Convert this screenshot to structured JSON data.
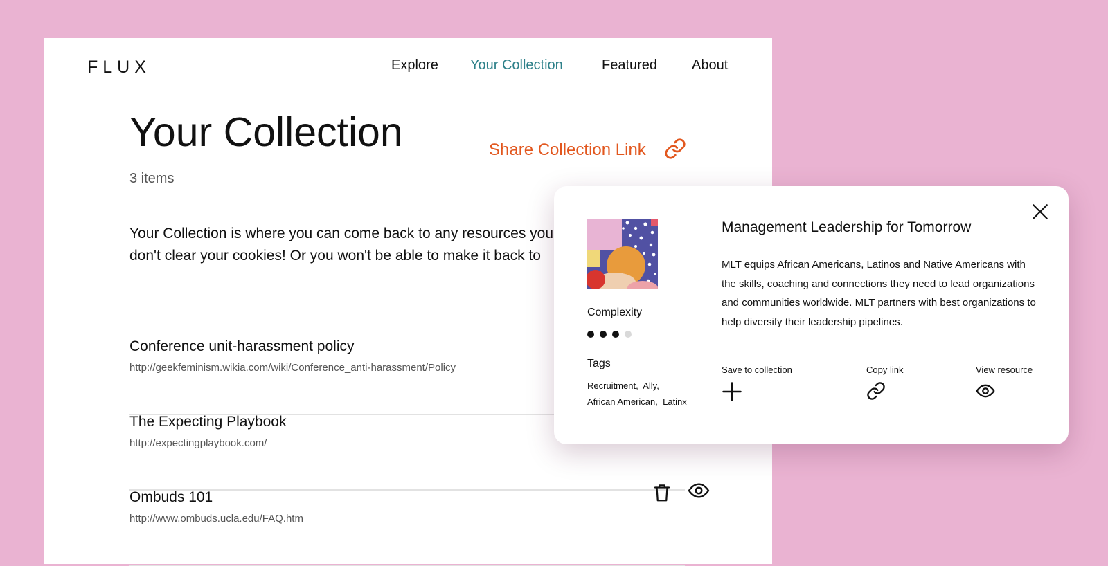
{
  "brand": {
    "logo": "FLUX"
  },
  "nav": {
    "items": [
      "Explore",
      "Your Collection",
      "Featured",
      "About"
    ],
    "active_index": 1,
    "active_color": "#2d8089"
  },
  "collection": {
    "title": "Your Collection",
    "share_label": "Share Collection Link",
    "count_label": "3 items",
    "intro": "Your Collection is where you can come back to any resources you don't clear your cookies! Or you won't be able to make it back to",
    "items": [
      {
        "title": "Conference unit-harassment policy",
        "url": "http://geekfeminism.wikia.com/wiki/Conference_anti-harassment/Policy"
      },
      {
        "title": "The Expecting Playbook",
        "url": "http://expectingplaybook.com/"
      },
      {
        "title": "Ombuds 101",
        "url": "http://www.ombuds.ucla.edu/FAQ.htm"
      }
    ]
  },
  "popup": {
    "title": "Management Leadership for Tomorrow",
    "description": "MLT equips African Americans, Latinos and Native Americans with the skills, coaching and connections they need to lead organizations and communities worldwide. MLT partners with best organizations to help diversify their leadership pipelines.",
    "complexity_label": "Complexity",
    "complexity": {
      "level": 3,
      "max": 4
    },
    "tags_label": "Tags",
    "tags": [
      "Recruitment,",
      "Ally,",
      "African American,",
      "Latinx"
    ],
    "actions": {
      "save": "Save to collection",
      "copy": "Copy link",
      "view": "View resource"
    }
  },
  "colors": {
    "background": "#eab3d2",
    "accent_orange": "#e2571e",
    "accent_teal": "#2d8089"
  },
  "icons": {
    "share": "link-icon",
    "close": "close-icon",
    "save": "plus-icon",
    "copy": "link-icon",
    "view": "eye-icon",
    "delete": "trash-icon"
  }
}
